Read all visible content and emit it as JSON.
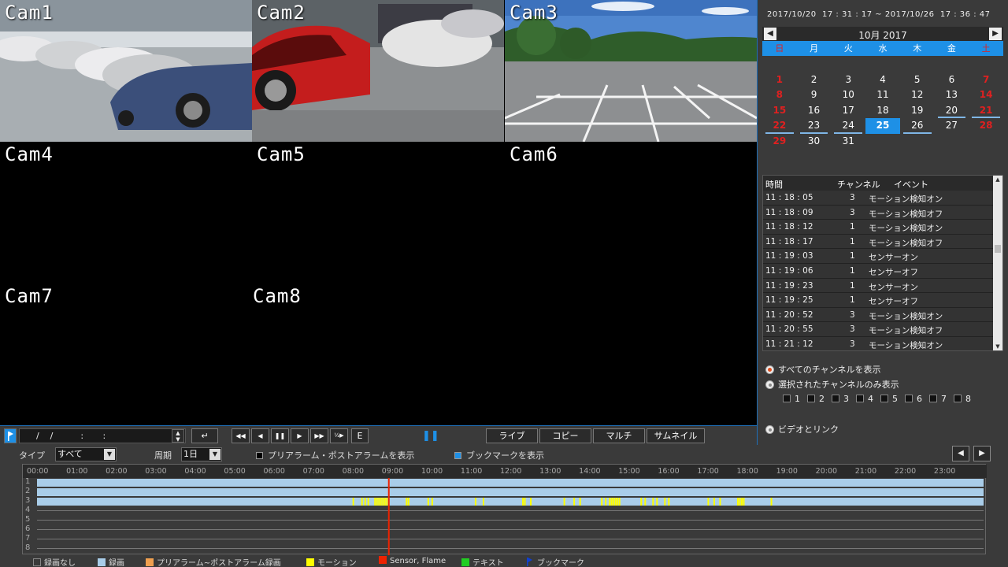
{
  "cameras": [
    {
      "label": "Cam1",
      "feed": "parking-lot-cars"
    },
    {
      "label": "Cam2",
      "feed": "parking-lot-red-car"
    },
    {
      "label": "Cam3",
      "feed": "empty-parking-lot"
    },
    {
      "label": "Cam4",
      "feed": "none"
    },
    {
      "label": "Cam5",
      "feed": "none"
    },
    {
      "label": "Cam6",
      "feed": "none"
    },
    {
      "label": "Cam7",
      "feed": "none"
    },
    {
      "label": "Cam8",
      "feed": "none"
    }
  ],
  "right_panel": {
    "date_range": "2017/10/20  17 : 31 : 17 ~ 2017/10/26  17 : 36 : 47",
    "calendar": {
      "title": "10月   2017",
      "prev_icon": "triangle-left-icon",
      "next_icon": "triangle-right-icon",
      "weekdays": [
        "日",
        "月",
        "火",
        "水",
        "木",
        "金",
        "土"
      ],
      "blank_leading": 7,
      "days": [
        1,
        2,
        3,
        4,
        5,
        6,
        7,
        8,
        9,
        10,
        11,
        12,
        13,
        14,
        15,
        16,
        17,
        18,
        19,
        20,
        21,
        22,
        23,
        24,
        25,
        26,
        27,
        28,
        29,
        30,
        31
      ],
      "red_days": [
        1,
        7,
        8,
        14,
        15,
        21,
        22,
        28,
        29
      ],
      "recorded_days": [
        20,
        21,
        22,
        23,
        24,
        26
      ],
      "selected_day": 25
    },
    "event_list": {
      "headers": {
        "time": "時間",
        "channel": "チャンネル",
        "event": "イベント"
      },
      "rows": [
        {
          "time": "11 : 18 : 05",
          "channel": "3",
          "event": "モーション検知オン"
        },
        {
          "time": "11 : 18 : 09",
          "channel": "3",
          "event": "モーション検知オフ"
        },
        {
          "time": "11 : 18 : 12",
          "channel": "1",
          "event": "モーション検知オン"
        },
        {
          "time": "11 : 18 : 17",
          "channel": "1",
          "event": "モーション検知オフ"
        },
        {
          "time": "11 : 19 : 03",
          "channel": "1",
          "event": "センサーオン"
        },
        {
          "time": "11 : 19 : 06",
          "channel": "1",
          "event": "センサーオフ"
        },
        {
          "time": "11 : 19 : 23",
          "channel": "1",
          "event": "センサーオン"
        },
        {
          "time": "11 : 19 : 25",
          "channel": "1",
          "event": "センサーオフ"
        },
        {
          "time": "11 : 20 : 52",
          "channel": "3",
          "event": "モーション検知オン"
        },
        {
          "time": "11 : 20 : 55",
          "channel": "3",
          "event": "モーション検知オフ"
        },
        {
          "time": "11 : 21 : 12",
          "channel": "3",
          "event": "モーション検知オン"
        }
      ]
    },
    "options": {
      "show_all_channels": "すべてのチャンネルを表示",
      "show_selected_channels": "選択されたチャンネルのみ表示",
      "channels": [
        "1",
        "2",
        "3",
        "4",
        "5",
        "6",
        "7",
        "8"
      ],
      "video_link": "ビデオとリンク"
    }
  },
  "controls": {
    "datetime_value": "      /    /          :       :",
    "buttons": {
      "enter": "↵",
      "rewind_fast": "◀◀",
      "step_back": "◀",
      "pause": "❚❚",
      "play": "▶",
      "fast_forward": "▶▶",
      "half_speed": "½▶",
      "end": "E"
    },
    "pause_indicator": "❚❚",
    "modes": {
      "live": "ライブ",
      "copy": "コピー",
      "multi": "マルチ",
      "thumbnail": "サムネイル"
    }
  },
  "filter": {
    "type_label": "タイプ",
    "type_value": "すべて",
    "interval_label": "周期",
    "interval_value": "1日",
    "show_prealarm": "プリアラーム・ポストアラームを表示",
    "show_bookmark": "ブックマークを表示"
  },
  "timeline": {
    "hours": [
      "00:00",
      "01:00",
      "02:00",
      "03:00",
      "04:00",
      "05:00",
      "06:00",
      "07:00",
      "08:00",
      "09:00",
      "10:00",
      "11:00",
      "12:00",
      "13:00",
      "14:00",
      "15:00",
      "16:00",
      "17:00",
      "18:00",
      "19:00",
      "20:00",
      "21:00",
      "22:00",
      "23:00"
    ],
    "channels": [
      "1",
      "2",
      "3",
      "4",
      "5",
      "6",
      "7",
      "8"
    ],
    "recorded_channels": [
      "1",
      "2",
      "3"
    ],
    "playhead_hour": 8.9,
    "motion_hours_ch3": [
      8.0,
      8.22,
      8.3,
      8.38,
      8.55,
      8.6,
      8.65,
      8.7,
      8.75,
      8.8,
      8.85,
      9.35,
      9.4,
      9.9,
      10.0,
      11.1,
      11.3,
      12.3,
      12.35,
      12.5,
      13.35,
      13.6,
      13.75,
      14.3,
      14.4,
      14.5,
      14.55,
      14.6,
      14.65,
      14.7,
      14.75,
      15.3,
      15.4,
      15.6,
      15.7,
      15.9,
      16.0,
      17.0,
      17.15,
      17.3,
      17.75,
      17.8,
      17.85,
      17.9,
      18.6
    ]
  },
  "legend": [
    {
      "label": "録画なし",
      "color": "#3a3a3a"
    },
    {
      "label": "録画",
      "color": "#a9cde9"
    },
    {
      "label": "プリアラーム~ポストアラーム録画",
      "color": "#f0a050"
    },
    {
      "label": "モーション",
      "color": "#ffff00"
    },
    {
      "label": "Sensor, Flame",
      "color": "#ee2200"
    },
    {
      "label": "テキスト",
      "color": "#22cc22"
    },
    {
      "label": "ブックマーク",
      "color": "#1040d0"
    }
  ]
}
